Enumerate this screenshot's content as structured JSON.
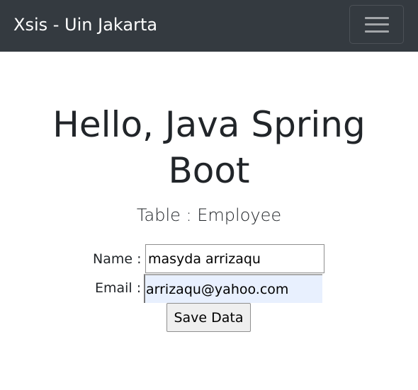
{
  "navbar": {
    "brand": "Xsis - Uin Jakarta",
    "toggler_icon": "hamburger-menu-icon",
    "background_color": "#343a40"
  },
  "main": {
    "heading": "Hello, Java Spring Boot",
    "subtitle": "Table : Employee"
  },
  "form": {
    "name_label": "Name :",
    "name_value": "masyda arrizaqu",
    "email_label": "Email :",
    "email_value": "arrizaqu@yahoo.com",
    "submit_label": "Save Data"
  }
}
